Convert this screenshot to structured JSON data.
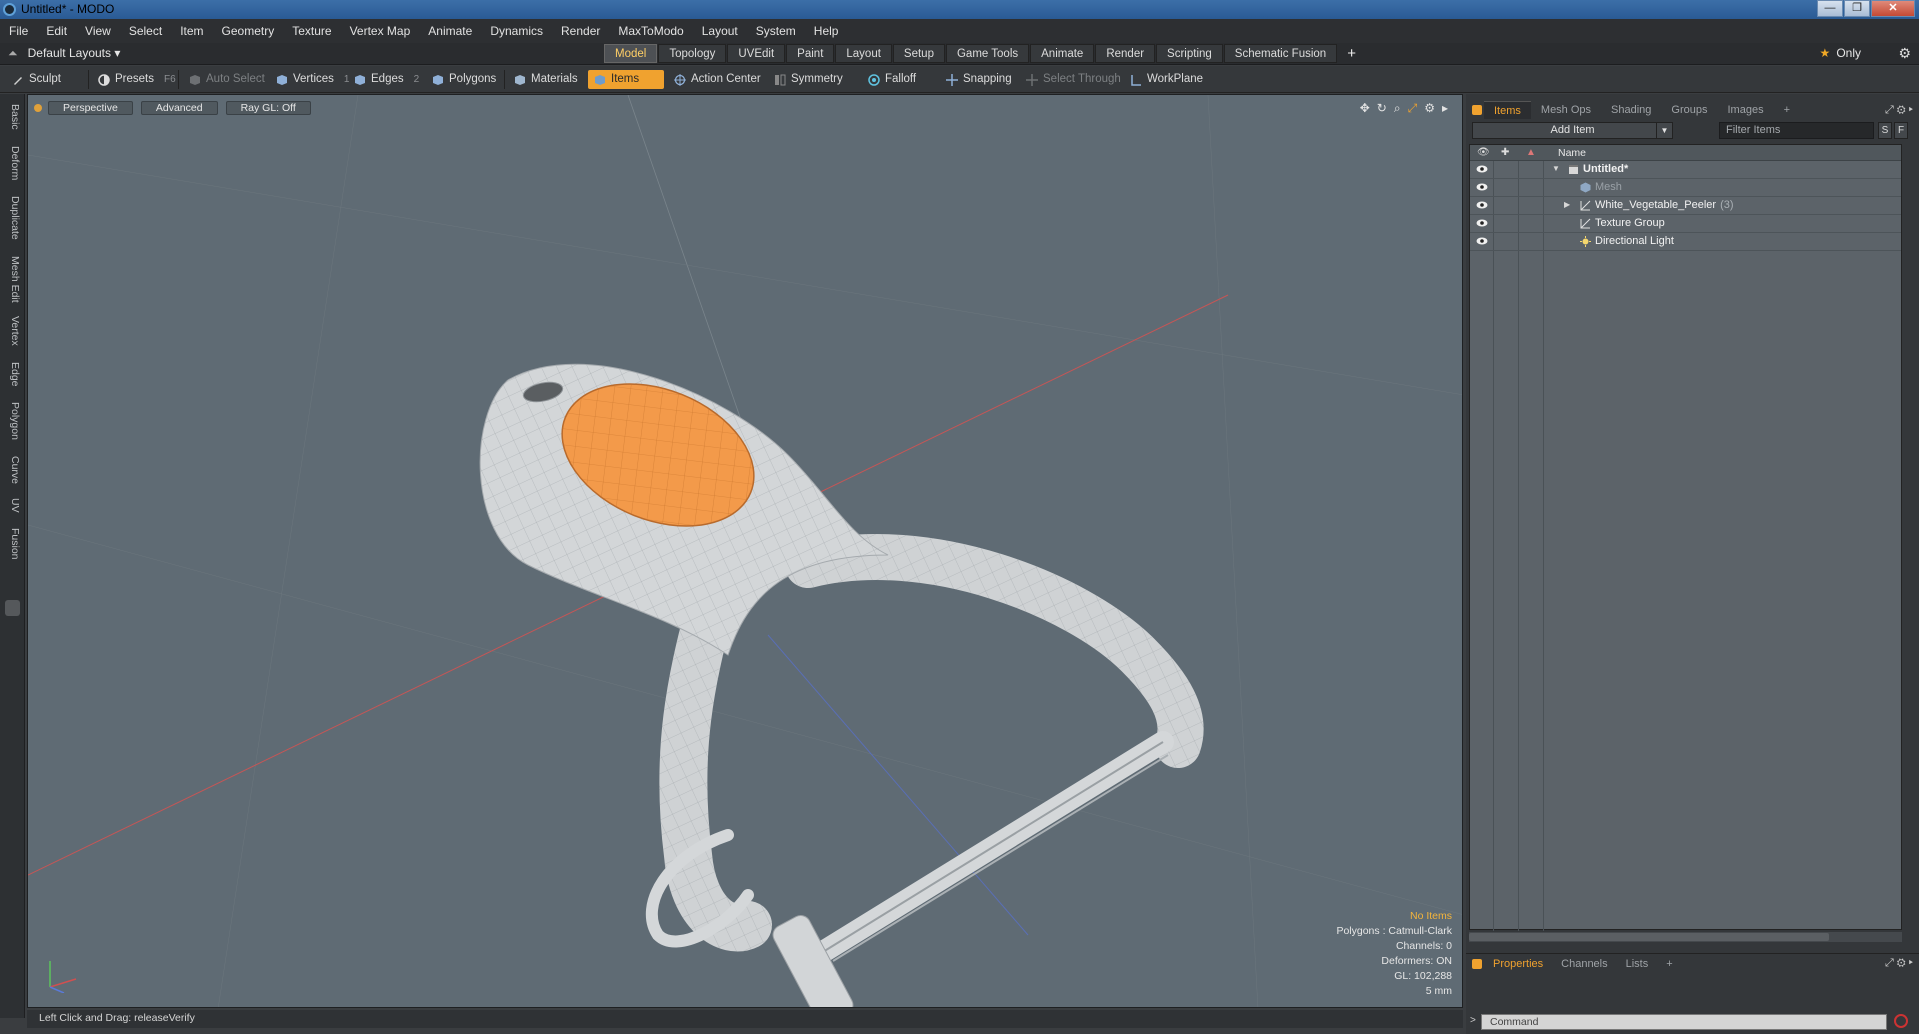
{
  "window": {
    "title": "Untitled* - MODO",
    "controls": [
      "minimize",
      "maximize",
      "close"
    ]
  },
  "menu": [
    "File",
    "Edit",
    "View",
    "Select",
    "Item",
    "Geometry",
    "Texture",
    "Vertex Map",
    "Animate",
    "Dynamics",
    "Render",
    "MaxToModo",
    "Layout",
    "System",
    "Help"
  ],
  "layout_bar": {
    "layouts_label": "Default Layouts",
    "tabs": [
      "Model",
      "Topology",
      "UVEdit",
      "Paint",
      "Layout",
      "Setup",
      "Game Tools",
      "Animate",
      "Render",
      "Scripting",
      "Schematic Fusion"
    ],
    "active_tab": "Model",
    "only_label": "Only"
  },
  "toolbar": {
    "sculpt": "Sculpt",
    "presets": "Presets",
    "presets_key": "F6",
    "auto_select": "Auto Select",
    "vertices": "Vertices",
    "vertices_key": "1",
    "edges": "Edges",
    "edges_key": "2",
    "polygons": "Polygons",
    "materials": "Materials",
    "items": "Items",
    "action_center": "Action Center",
    "symmetry": "Symmetry",
    "falloff": "Falloff",
    "snapping": "Snapping",
    "select_through": "Select Through",
    "workplane": "WorkPlane"
  },
  "left_tabs": [
    "Basic",
    "Deform",
    "Duplicate",
    "Mesh Edit",
    "Vertex",
    "Edge",
    "Polygon",
    "Curve",
    "UV",
    "Fusion"
  ],
  "viewport": {
    "view_label": "Perspective",
    "shading_label": "Advanced",
    "raygl_label": "Ray GL: Off",
    "info": {
      "selection": "No Items",
      "polygons": "Polygons : Catmull-Clark",
      "channels": "Channels: 0",
      "deformers": "Deformers: ON",
      "gl": "GL: 102,288",
      "grid": "5 mm"
    },
    "colors": {
      "background": "#5f6b74",
      "handle": "#e8e8e8",
      "grip": "#f39a4a"
    }
  },
  "status_line": "Left Click and Drag:   releaseVerify",
  "items_panel": {
    "tabs": [
      "Items",
      "Mesh Ops",
      "Shading",
      "Groups",
      "Images"
    ],
    "active_tab": "Items",
    "add_item_label": "Add Item",
    "filter_placeholder": "Filter Items",
    "s_btn": "S",
    "f_btn": "F",
    "name_header": "Name",
    "tree": [
      {
        "label": "Untitled*",
        "count": "",
        "icon": "scene-icon",
        "indent": 0,
        "expander": "▼",
        "bold": true
      },
      {
        "label": "Mesh",
        "count": "",
        "icon": "mesh-icon",
        "indent": 1,
        "expander": "",
        "dim": true
      },
      {
        "label": "White_Vegetable_Peeler",
        "count": "(3)",
        "icon": "locator-icon",
        "indent": 1,
        "expander": "▶"
      },
      {
        "label": "Texture Group",
        "count": "",
        "icon": "group-icon",
        "indent": 1,
        "expander": ""
      },
      {
        "label": "Directional Light",
        "count": "",
        "icon": "light-icon",
        "indent": 1,
        "expander": ""
      }
    ]
  },
  "properties_panel": {
    "tabs": [
      "Properties",
      "Channels",
      "Lists"
    ],
    "active_tab": "Properties"
  },
  "command": {
    "placeholder": "Command"
  }
}
